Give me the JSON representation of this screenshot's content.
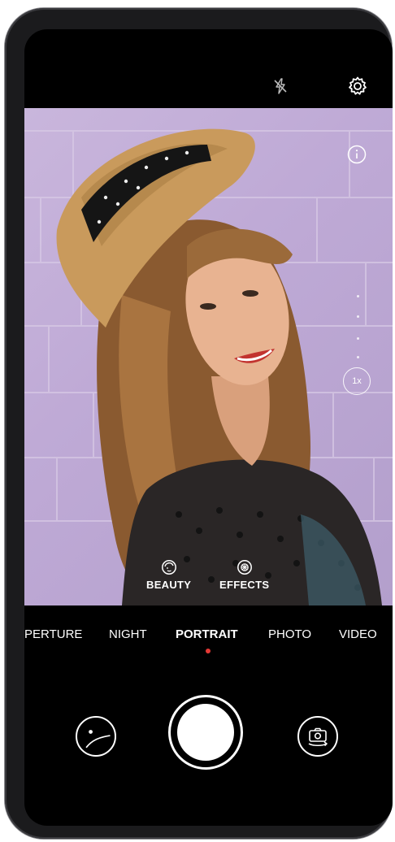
{
  "top_bar": {
    "flash_icon": "flash-off-icon",
    "settings_icon": "gear-icon"
  },
  "viewfinder": {
    "info_icon": "info-icon",
    "zoom_label": "1x"
  },
  "quick_options": [
    {
      "label": "BEAUTY",
      "icon": "beauty-icon"
    },
    {
      "label": "EFFECTS",
      "icon": "effects-icon"
    }
  ],
  "modes": [
    {
      "label": "APERTURE",
      "visible_text": "PERTURE",
      "active": false
    },
    {
      "label": "NIGHT",
      "active": false
    },
    {
      "label": "PORTRAIT",
      "active": true
    },
    {
      "label": "PHOTO",
      "active": false
    },
    {
      "label": "VIDEO",
      "active": false
    }
  ],
  "controls": {
    "gallery_icon": "gallery-thumbnail-icon",
    "shutter_icon": "shutter-button",
    "switch_camera_icon": "switch-camera-icon"
  },
  "colors": {
    "accent_dot": "#e53935",
    "background": "#000000",
    "wall": "#c9b6dc"
  }
}
